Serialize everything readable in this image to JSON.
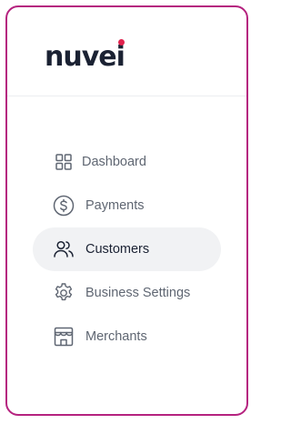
{
  "brand": {
    "name": "nuvei",
    "dot_color": "#e0234e",
    "text_color": "#1b2233"
  },
  "frame": {
    "border_color": "#b5227f"
  },
  "sidebar": {
    "items": [
      {
        "label": "Dashboard",
        "icon": "grid-icon",
        "active": false
      },
      {
        "label": "Payments",
        "icon": "dollar-circle-icon",
        "active": false
      },
      {
        "label": "Customers",
        "icon": "users-icon",
        "active": true
      },
      {
        "label": "Business Settings",
        "icon": "gear-icon",
        "active": false
      },
      {
        "label": "Merchants",
        "icon": "store-icon",
        "active": false
      }
    ]
  }
}
